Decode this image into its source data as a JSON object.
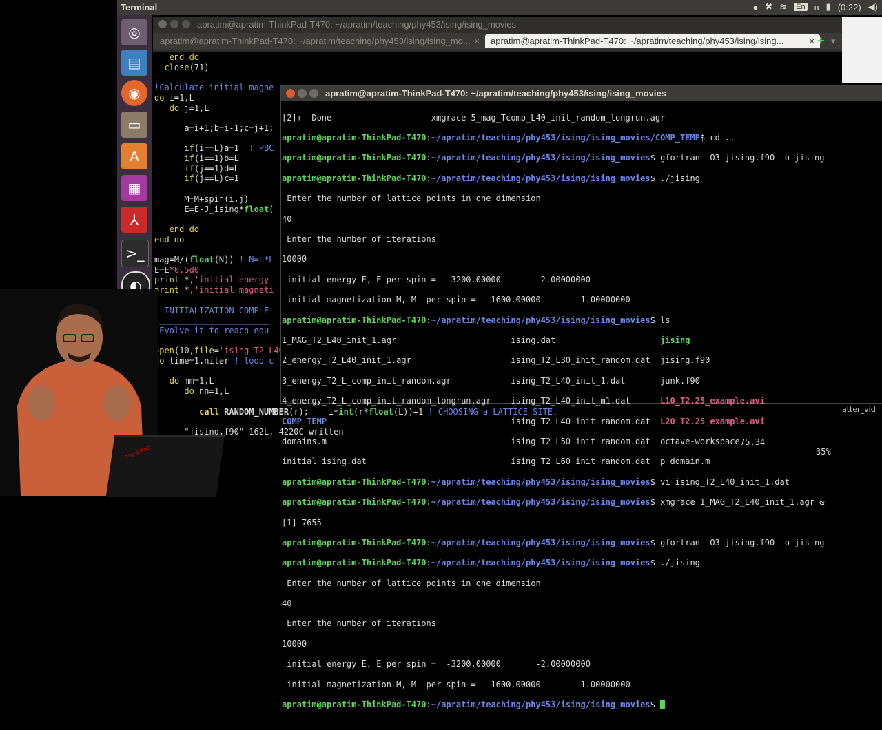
{
  "topbar": {
    "app_title": "Terminal",
    "keyboard_layout": "En",
    "battery": "(0:22)"
  },
  "back_window": {
    "title": "apratim@apratim-ThinkPad-T470: ~/apratim/teaching/phy453/ising/ising_movies",
    "tabs": [
      {
        "label": "apratim@apratim-ThinkPad-T470: ~/apratim/teaching/phy453/ising/ising_mo...",
        "close": "×",
        "active": false
      },
      {
        "label": "apratim@apratim-ThinkPad-T470: ~/apratim/teaching/phy453/ising/ising...",
        "close": "×",
        "active": true
      }
    ],
    "status_line": {
      "file": "\"jising.f90\" 162L, 4220C written",
      "position": "75,34",
      "percent": "35%"
    }
  },
  "front_window": {
    "title": "apratim@apratim-ThinkPad-T470: ~/apratim/teaching/phy453/ising/ising_movies"
  },
  "icons": {
    "launcher": [
      "ubuntu-dash-icon",
      "files-icon",
      "firefox-icon",
      "file-manager-icon",
      "software-center-icon",
      "impress-icon",
      "pdf-reader-icon",
      "terminal-icon",
      "obs-icon",
      "grace-plot-icon"
    ]
  },
  "right_edge_label": "atter_vid",
  "laptop_brand": "ThinkPad"
}
